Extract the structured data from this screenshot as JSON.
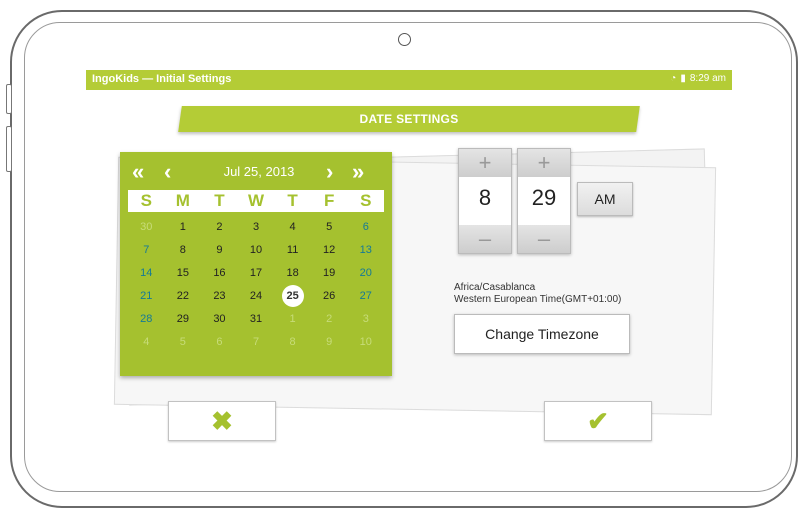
{
  "status_bar": {
    "app_title": "IngoKids — Initial Settings",
    "wifi_icon": "◔",
    "battery_icon": "▮",
    "time": "8:29 am"
  },
  "header": {
    "title": "DATE SETTINGS"
  },
  "calendar": {
    "nav": {
      "prev_year": "«",
      "prev_month": "‹",
      "next_month": "›",
      "next_year": "»"
    },
    "month_label": "Jul 25, 2013",
    "weekdays": [
      "S",
      "M",
      "T",
      "W",
      "T",
      "F",
      "S"
    ],
    "weeks": [
      [
        "30",
        "1",
        "2",
        "3",
        "4",
        "5",
        "6"
      ],
      [
        "7",
        "8",
        "9",
        "10",
        "11",
        "12",
        "13"
      ],
      [
        "14",
        "15",
        "16",
        "17",
        "18",
        "19",
        "20"
      ],
      [
        "21",
        "22",
        "23",
        "24",
        "25",
        "26",
        "27"
      ],
      [
        "28",
        "29",
        "30",
        "31",
        "1",
        "2",
        "3"
      ],
      [
        "4",
        "5",
        "6",
        "7",
        "8",
        "9",
        "10"
      ]
    ],
    "selected_day": "25"
  },
  "time": {
    "hour": "8",
    "minute": "29",
    "plus_symbol": "+",
    "minus_symbol": "–",
    "ampm": "AM"
  },
  "timezone": {
    "region": "Africa/Casablanca",
    "description": "Western European Time(GMT+01:00)",
    "change_button": "Change Timezone"
  },
  "actions": {
    "cancel_symbol": "✖",
    "confirm_symbol": "✔"
  },
  "colors": {
    "accent": "#b4cc36",
    "calendar": "#a5c12f",
    "weekend": "#157a96"
  }
}
